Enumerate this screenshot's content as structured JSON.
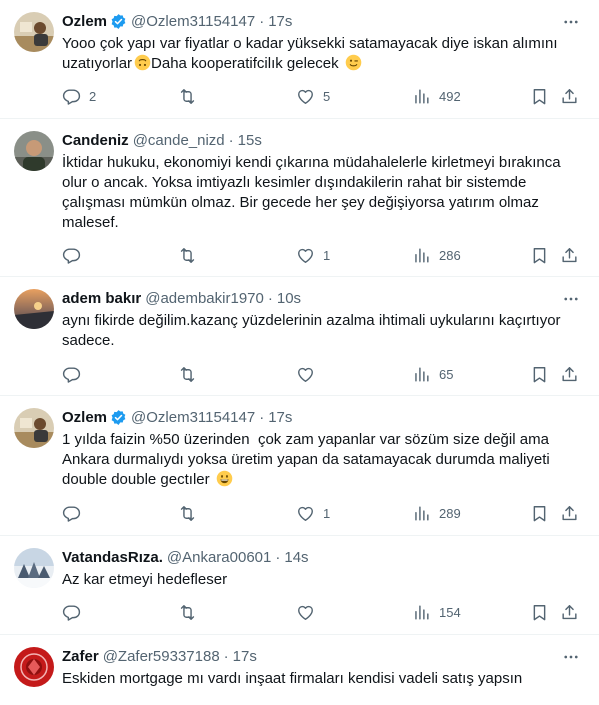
{
  "tweets": [
    {
      "name": "Ozlem",
      "verified": true,
      "handle": "@Ozlem31154147",
      "time": "17s",
      "avatar": "avatar-photo-desk",
      "text_lines": [
        "Yooo çok yapı var fiyatlar o kadar yüksekki satamayacak diye iskan alımını",
        "uzatıyorlar"
      ],
      "emoji_1": "upside-down-face-emoji",
      "text_tail": "Daha kooperatifcilık gelecek",
      "emoji_2": "winking-face-emoji",
      "replies": "2",
      "reposts": "",
      "likes": "5",
      "views": "492"
    },
    {
      "name": "Candeniz",
      "verified": false,
      "handle": "@cande_nizd",
      "time": "15s",
      "avatar": "avatar-photo-man",
      "text": "İktidar hukuku, ekonomiyi kendi çıkarına müdahalelerle kirletmeyi bırakınca\nolur o ancak. Yoksa imtiyazlı kesimler dışındakilerin rahat bir sistemde\nçalışması mümkün olmaz. Bir gecede her şey değişiyorsa yatırım olmaz\nmalesef.",
      "replies": "",
      "reposts": "",
      "likes": "1",
      "views": "286"
    },
    {
      "name": "adem bakır",
      "verified": false,
      "handle": "@adembakir1970",
      "time": "10s",
      "avatar": "avatar-photo-sunset",
      "text": "aynı fikirde değilim.kazanç yüzdelerinin azalma ihtimali uykularını kaçırtıyor\nsadece.",
      "replies": "",
      "reposts": "",
      "likes": "",
      "views": "65"
    },
    {
      "name": "Ozlem",
      "verified": true,
      "handle": "@Ozlem31154147",
      "time": "17s",
      "avatar": "avatar-photo-desk",
      "text_lines": [
        "1 yılda faizin %50 üzerinden  çok zam yapanlar var sözüm size değil ama",
        "Ankara durmalıydı yoksa üretim yapan da satamayacak durumda maliyeti",
        "double double gectıler"
      ],
      "emoji_1": "grinning-face-emoji",
      "replies": "",
      "reposts": "",
      "likes": "1",
      "views": "289"
    },
    {
      "name": "VatandasRıza.",
      "verified": false,
      "handle": "@Ankara00601",
      "time": "14s",
      "avatar": "avatar-photo-snow",
      "text": "Az kar etmeyi hedefleser",
      "replies": "",
      "reposts": "",
      "likes": "",
      "views": "154"
    },
    {
      "name": "Zafer",
      "verified": false,
      "handle": "@Zafer59337188",
      "time": "17s",
      "avatar": "avatar-photo-red-emblem",
      "text": "Eskiden mortgage mı vardı inşaat firmaları kendisi vadeli satış yapsın"
    }
  ],
  "dot": "·",
  "colors": {
    "secondary_text": "#536471",
    "verified_blue": "#1d9bf0",
    "divider": "#eff3f4"
  }
}
